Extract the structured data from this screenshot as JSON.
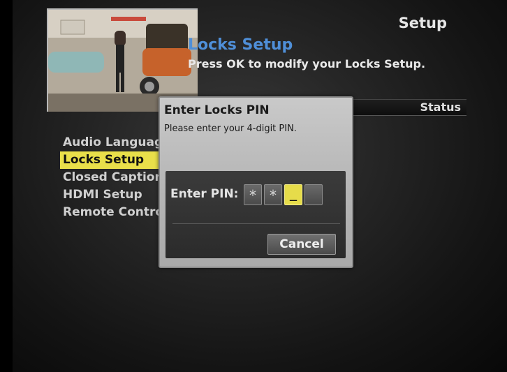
{
  "header": {
    "page_title": "Setup",
    "section_title": "Locks Setup",
    "section_description": "Press OK to modify your Locks Setup."
  },
  "status_bar": {
    "label": "Status"
  },
  "menu": {
    "items": [
      {
        "label": "Audio Language",
        "selected": false
      },
      {
        "label": "Locks Setup",
        "selected": true
      },
      {
        "label": "Closed Captioning",
        "selected": false
      },
      {
        "label": "HDMI Setup",
        "selected": false
      },
      {
        "label": "Remote Control",
        "selected": false
      }
    ]
  },
  "dialog": {
    "title": "Enter Locks PIN",
    "message": "Please enter your 4-digit PIN.",
    "pin_label": "Enter PIN:",
    "pin_digits": [
      "*",
      "*",
      "_",
      ""
    ],
    "cancel_label": "Cancel"
  },
  "colors": {
    "highlight": "#e9df4a",
    "section_title": "#4f8fd8",
    "dialog_bg": "#c0c0c0"
  }
}
